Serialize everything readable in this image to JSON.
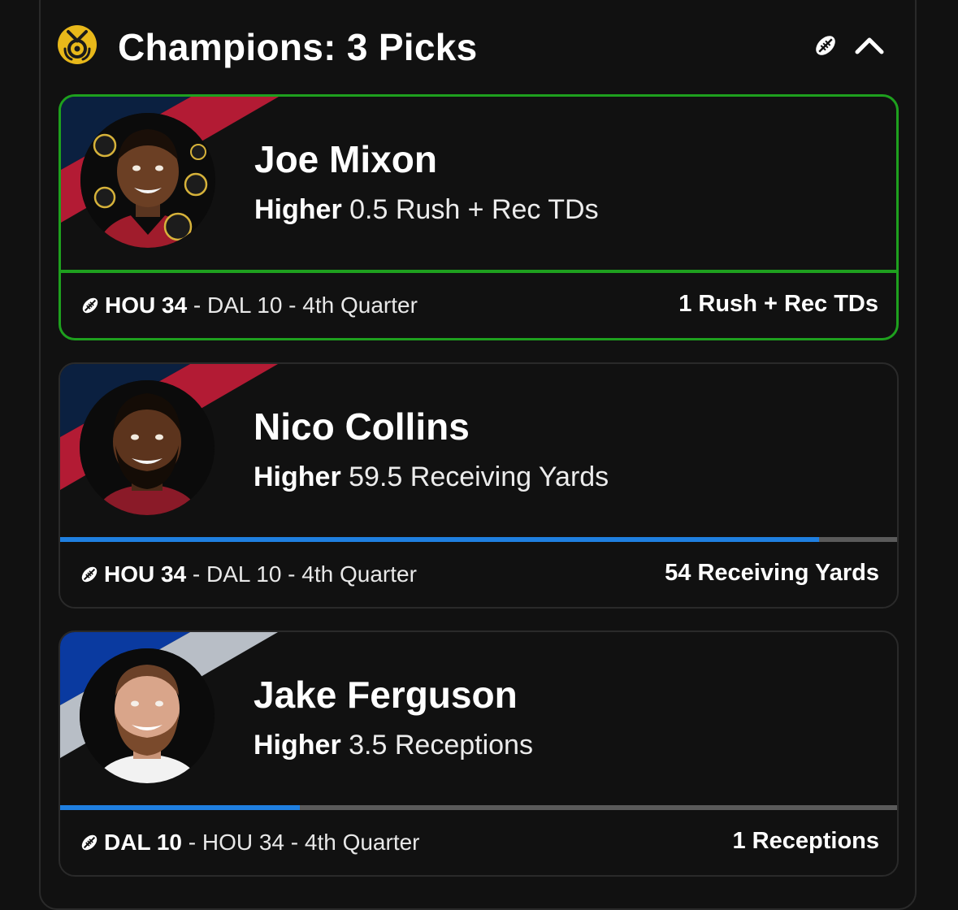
{
  "header": {
    "title": "Champions: 3 Picks",
    "medal_icon": "medal-icon",
    "sport_icon": "football-icon",
    "collapse_icon": "chevron-up-icon"
  },
  "colors": {
    "win_border": "#1ea01e",
    "progress_fill": "#1f7fe0",
    "progress_track": "#5a5a5a",
    "background": "#111111"
  },
  "picks": [
    {
      "name": "Joe Mixon",
      "direction": "Higher",
      "line": "0.5 Rush + Rec TDs",
      "status": "won",
      "game": {
        "icon": "football-icon",
        "team_score": "HOU 34",
        "rest": " - DAL 10 - 4th Quarter"
      },
      "stat": "1 Rush + Rec TDs"
    },
    {
      "name": "Nico Collins",
      "direction": "Higher",
      "line": "59.5 Receiving Yards",
      "status": "in-progress",
      "progress_fraction": 0.907,
      "game": {
        "icon": "football-icon",
        "team_score": "HOU 34",
        "rest": " - DAL 10 - 4th Quarter"
      },
      "stat": "54 Receiving Yards"
    },
    {
      "name": "Jake Ferguson",
      "direction": "Higher",
      "line": "3.5 Receptions",
      "status": "in-progress",
      "progress_fraction": 0.286,
      "game": {
        "icon": "football-icon",
        "team_score": "DAL 10",
        "rest": " - HOU 34 - 4th Quarter"
      },
      "stat": "1 Receptions"
    }
  ]
}
